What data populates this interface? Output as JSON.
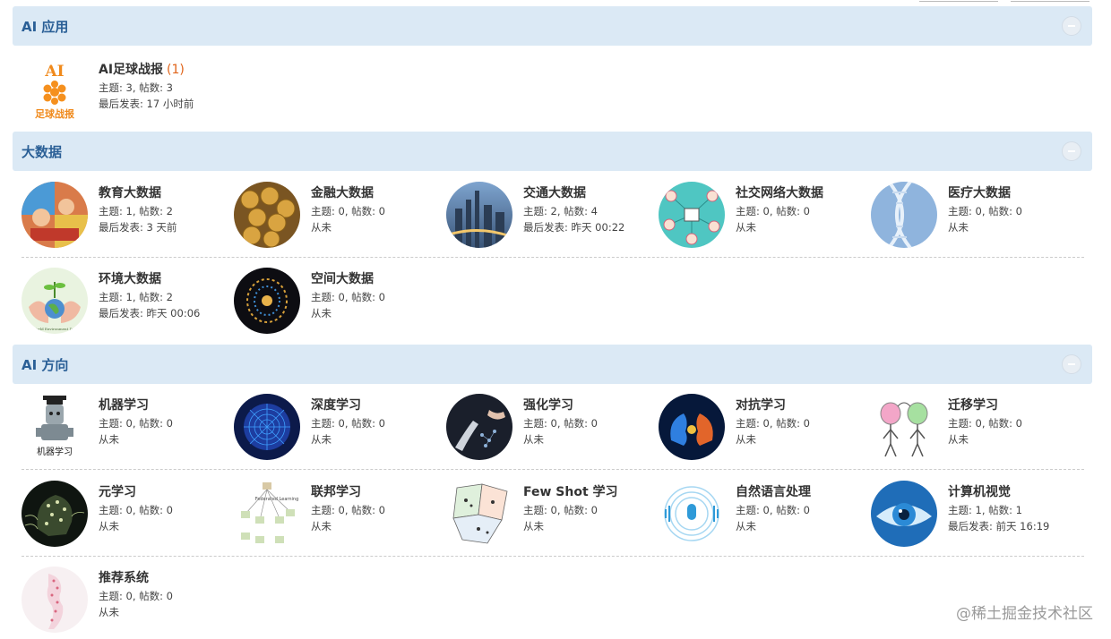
{
  "sections": {
    "ai_apps": {
      "title": "AI 应用",
      "forums": [
        {
          "name": "AI足球战报",
          "new": "(1)",
          "stats": "主题: 3, 帖数: 3",
          "last": "最后发表: 17 小时前"
        }
      ]
    },
    "bigdata": {
      "title": "大数据",
      "forums": [
        {
          "name": "教育大数据",
          "stats": "主题: 1, 帖数: 2",
          "last": "最后发表: 3 天前"
        },
        {
          "name": "金融大数据",
          "stats": "主题: 0, 帖数: 0",
          "last": "从未"
        },
        {
          "name": "交通大数据",
          "stats": "主题: 2, 帖数: 4",
          "last": "最后发表: 昨天 00:22"
        },
        {
          "name": "社交网络大数据",
          "stats": "主题: 0, 帖数: 0",
          "last": "从未"
        },
        {
          "name": "医疗大数据",
          "stats": "主题: 0, 帖数: 0",
          "last": "从未"
        },
        {
          "name": "环境大数据",
          "stats": "主题: 1, 帖数: 2",
          "last": "最后发表: 昨天 00:06"
        },
        {
          "name": "空间大数据",
          "stats": "主题: 0, 帖数: 0",
          "last": "从未"
        }
      ]
    },
    "ai_direction": {
      "title": "AI 方向",
      "forums": [
        {
          "name": "机器学习",
          "stats": "主题: 0, 帖数: 0",
          "last": "从未"
        },
        {
          "name": "深度学习",
          "stats": "主题: 0, 帖数: 0",
          "last": "从未"
        },
        {
          "name": "强化学习",
          "stats": "主题: 0, 帖数: 0",
          "last": "从未"
        },
        {
          "name": "对抗学习",
          "stats": "主题: 0, 帖数: 0",
          "last": "从未"
        },
        {
          "name": "迁移学习",
          "stats": "主题: 0, 帖数: 0",
          "last": "从未"
        },
        {
          "name": "元学习",
          "stats": "主题: 0, 帖数: 0",
          "last": "从未"
        },
        {
          "name": "联邦学习",
          "stats": "主题: 0, 帖数: 0",
          "last": "从未"
        },
        {
          "name": "Few Shot 学习",
          "stats": "主题: 0, 帖数: 0",
          "last": "从未"
        },
        {
          "name": "自然语言处理",
          "stats": "主题: 0, 帖数: 0",
          "last": "从未"
        },
        {
          "name": "计算机视觉",
          "stats": "主题: 1, 帖数: 1",
          "last": "最后发表: 前天 16:19"
        },
        {
          "name": "推荐系统",
          "stats": "主题: 0, 帖数: 0",
          "last": "从未"
        }
      ]
    }
  },
  "logo_text": {
    "top": "AI",
    "bottom": "足球战报"
  },
  "image_labels": {
    "machine_learning": "机器学习",
    "federated": "Federated Learning",
    "environment": "World Environment Day"
  },
  "watermark": "@稀土掘金技术社区",
  "colors": {
    "section_bg": "#dbe9f5",
    "section_title": "#2a5f96",
    "new_count": "#e0641a"
  }
}
